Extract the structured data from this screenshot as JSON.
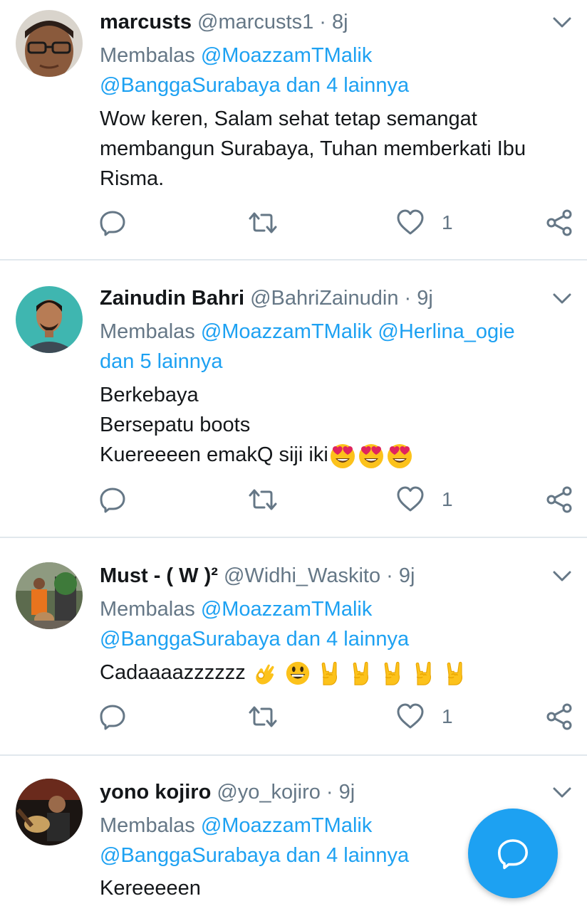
{
  "colors": {
    "link": "#1da1f2",
    "muted": "#657786",
    "fab": "#1da1f2"
  },
  "tweets": [
    {
      "avatar_icon": "user-avatar-glasses",
      "name": "marcusts",
      "handle": "@marcusts1 · 8j",
      "reply_prefix": "Membalas ",
      "reply_line1_link": "@MoazzamTMalik",
      "reply_line2": "@BanggaSurabaya dan 4 lainnya",
      "body_lines": [
        "Wow keren, Salam sehat tetap semangat",
        "membangun Surabaya, Tuhan memberkati Ibu",
        "Risma."
      ],
      "like_count": "1"
    },
    {
      "avatar_icon": "user-avatar-teal",
      "name": "Zainudin Bahri",
      "handle": "@BahriZainudin · 9j",
      "reply_prefix": "Membalas ",
      "reply_line1_link": "@MoazzamTMalik @Herlina_ogie",
      "reply_line2": "dan 5 lainnya",
      "body_lines": [
        "Berkebaya",
        "Bersepatu boots",
        "Kuereeeen emakQ siji iki"
      ],
      "body_emojis": "heart-eyes-emoji ×3",
      "like_count": "1"
    },
    {
      "avatar_icon": "user-avatar-outdoor",
      "name": "Must - ( W )²",
      "handle": "@Widhi_Waskito · 9j",
      "reply_prefix": "Membalas ",
      "reply_line1_link": "@MoazzamTMalik",
      "reply_line2": "@BanggaSurabaya dan 4 lainnya",
      "body_lines": [
        "Cadaaaazzzzzz"
      ],
      "body_emojis": "ok-hand, grin, rock-on ×5",
      "like_count": "1"
    },
    {
      "avatar_icon": "user-avatar-guitar",
      "name": "yono kojiro",
      "handle": "@yo_kojiro · 9j",
      "reply_prefix": "Membalas ",
      "reply_line1_link": "@MoazzamTMalik",
      "reply_line2": "@BanggaSurabaya dan 4 lainnya",
      "body_lines": [
        "Kereeeeen"
      ]
    }
  ],
  "fab": {
    "icon": "compose-reply-icon"
  }
}
